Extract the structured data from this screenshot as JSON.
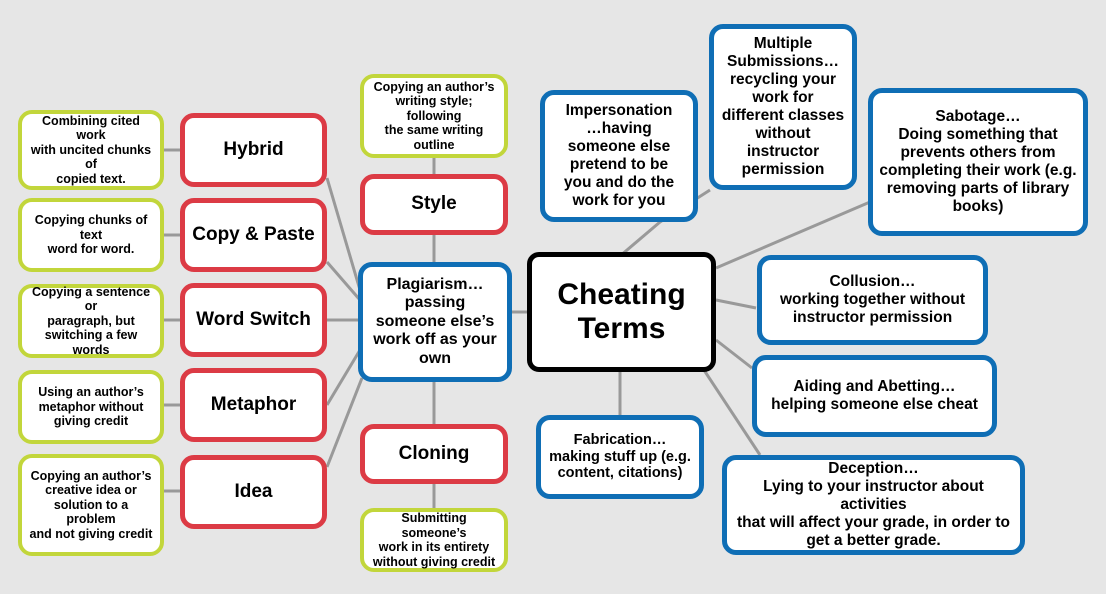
{
  "diagram": {
    "title": "Cheating Terms",
    "background_color": "#e6e6e6",
    "colors": {
      "green_border": "#c2d63b",
      "red_border": "#dc3b45",
      "blue_border": "#0f6eb5",
      "center_border": "#000000",
      "connector": "#999999",
      "node_fill": "#ffffff",
      "text": "#000000"
    }
  },
  "center": {
    "label": "Cheating\nTerms"
  },
  "plagiarism": {
    "label": "Plagiarism…\npassing\nsomeone else’s\nwork off as your\nown"
  },
  "plagiarism_types": [
    {
      "name": "Hybrid"
    },
    {
      "name": "Copy & Paste"
    },
    {
      "name": "Word Switch"
    },
    {
      "name": "Metaphor"
    },
    {
      "name": "Idea"
    },
    {
      "name": "Style"
    },
    {
      "name": "Cloning"
    }
  ],
  "descriptions": [
    {
      "text": "Combining cited work\nwith uncited chunks of\ncopied text."
    },
    {
      "text": "Copying chunks of text\nword for word."
    },
    {
      "text": "Copying a sentence or\nparagraph, but\nswitching a few words"
    },
    {
      "text": "Using an author’s\nmetaphor without\ngiving credit"
    },
    {
      "text": "Copying an author’s\ncreative idea or\nsolution to a problem\nand not giving credit"
    },
    {
      "text": "Copying an author’s\nwriting style; following\nthe same writing\noutline"
    },
    {
      "text": "Submitting someone’s\nwork in its entirety\nwithout giving credit"
    }
  ],
  "cheating_terms": [
    {
      "label": "Impersonation\n…having\nsomeone else\npretend to be\nyou and do the\nwork for you"
    },
    {
      "label": "Multiple\nSubmissions…\nrecycling your\nwork for\ndifferent classes\nwithout\ninstructor\npermission"
    },
    {
      "label": "Sabotage…\nDoing something that\nprevents others from\ncompleting their work (e.g.\nremoving parts of library\nbooks)"
    },
    {
      "label": "Collusion…\nworking together  without\ninstructor permission"
    },
    {
      "label": "Aiding and Abetting…\nhelping someone else cheat"
    },
    {
      "label": "Deception…\nLying to your instructor about activities\nthat will affect your grade, in order to\nget a better grade."
    },
    {
      "label": "Fabrication…\nmaking stuff up (e.g.\ncontent, citations)"
    }
  ]
}
